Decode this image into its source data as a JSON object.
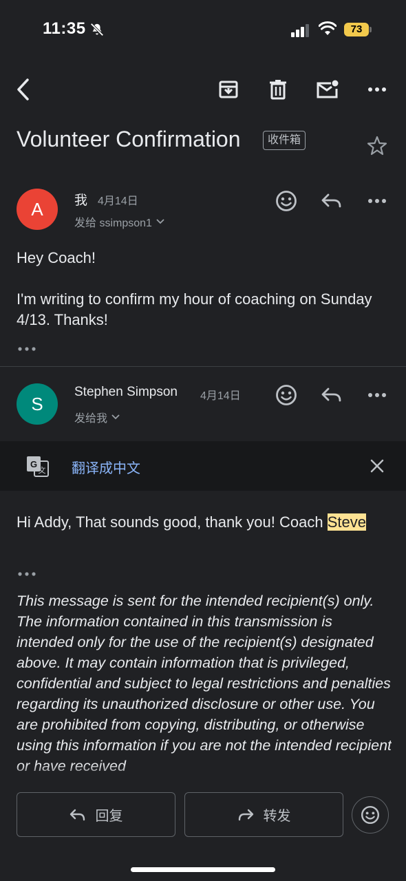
{
  "status_bar": {
    "time": "11:35",
    "battery": "73",
    "icons": [
      "bell-slash-icon",
      "cellular-signal-icon",
      "wifi-icon",
      "battery-icon"
    ]
  },
  "toolbar": {
    "icons": [
      "back-arrow-icon",
      "archive-icon",
      "trash-icon",
      "mark-unread-icon",
      "more-options-icon"
    ]
  },
  "email": {
    "subject": "Volunteer Confirmation",
    "label": "收件箱"
  },
  "messages": [
    {
      "avatar_letter": "A",
      "avatar_color": "#ea4335",
      "sender": "我",
      "date": "4月14日",
      "recipient": "发给 ssimpson1",
      "body": [
        "Hey Coach!",
        "I'm writing to confirm my hour of coaching on Sunday 4/13. Thanks!"
      ]
    },
    {
      "avatar_letter": "S",
      "avatar_color": "#00897b",
      "sender": "Stephen Simpson",
      "date": "4月14日",
      "recipient": "发给我",
      "body_prefix": "Hi Addy, That sounds good, thank you!  Coach ",
      "body_highlight": "Steve",
      "disclaimer": "This message is sent for the intended recipient(s) only. The information contained in this transmission is intended only for the use of the recipient(s) designated above.  It may contain information that is privileged, confidential and subject to legal restrictions and penalties regarding its unauthorized disclosure or other use. You are prohibited from copying, distributing, or otherwise using this information if you are not the intended recipient or have received"
    }
  ],
  "translate_bar": {
    "label": "翻译成中文"
  },
  "bottom_actions": {
    "reply": "回复",
    "forward": "转发"
  }
}
